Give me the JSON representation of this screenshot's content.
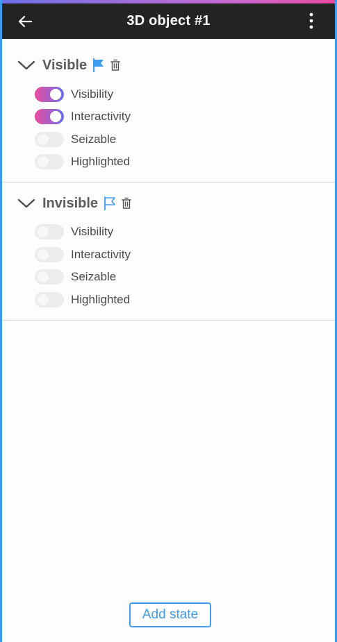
{
  "header": {
    "title": "3D object #1",
    "back_icon": "arrow-left-icon",
    "menu_icon": "more-vertical-icon"
  },
  "colors": {
    "accent": "#3d9bf0",
    "toggle_gradient_start": "#e84ba0",
    "toggle_gradient_end": "#6e72e6",
    "header_bg": "#232323"
  },
  "states": [
    {
      "name": "Visible",
      "flag": "filled",
      "options": [
        {
          "label": "Visibility",
          "on": true
        },
        {
          "label": "Interactivity",
          "on": true
        },
        {
          "label": "Seizable",
          "on": false
        },
        {
          "label": "Highlighted",
          "on": false
        }
      ]
    },
    {
      "name": "Invisible",
      "flag": "outline",
      "options": [
        {
          "label": "Visibility",
          "on": false
        },
        {
          "label": "Interactivity",
          "on": false
        },
        {
          "label": "Seizable",
          "on": false
        },
        {
          "label": "Highlighted",
          "on": false
        }
      ]
    }
  ],
  "footer": {
    "add_state_label": "Add state"
  }
}
